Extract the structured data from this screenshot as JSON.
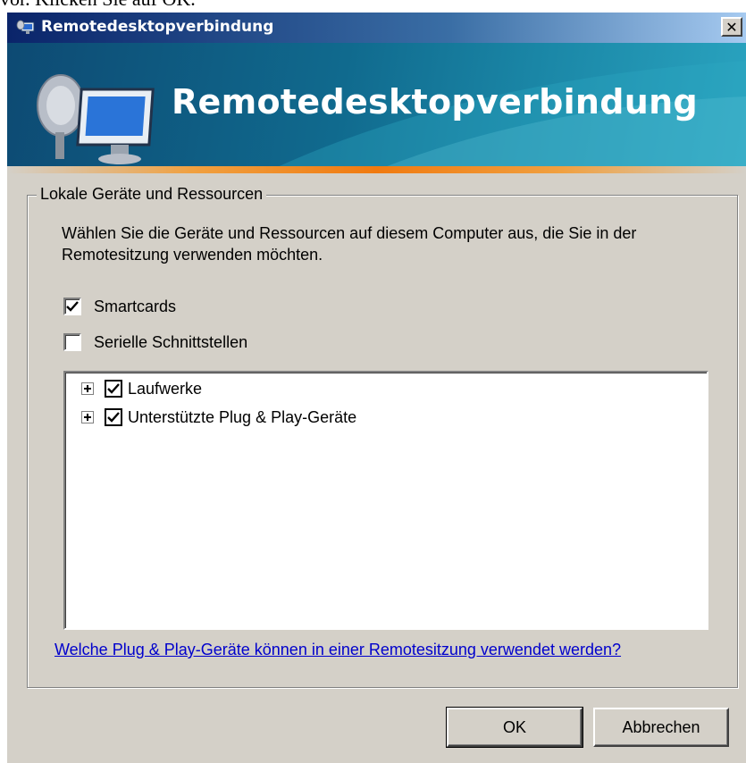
{
  "page_top_text": "vor. Klicken Sie auf OK.",
  "window": {
    "title": "Remotedesktopverbindung",
    "close_label": "✕"
  },
  "banner": {
    "title": "Remotedesktopverbindung"
  },
  "group": {
    "legend": "Lokale Geräte und Ressourcen",
    "description": "Wählen Sie die Geräte und Ressourcen auf diesem Computer aus, die Sie in der Remotesitzung verwenden möchten."
  },
  "checkboxes": [
    {
      "label": "Smartcards",
      "checked": true
    },
    {
      "label": "Serielle Schnittstellen",
      "checked": false
    }
  ],
  "tree": {
    "items": [
      {
        "label": "Laufwerke",
        "checked": true
      },
      {
        "label": "Unterstützte Plug & Play-Geräte",
        "checked": true
      }
    ]
  },
  "help_link": "Welche Plug & Play-Geräte können in einer Remotesitzung verwendet werden?",
  "buttons": {
    "ok": "OK",
    "cancel": "Abbrechen"
  },
  "colors": {
    "dialog_bg": "#d4d0c8",
    "titlebar_start": "#0a246a",
    "banner_bg": "#106a8e",
    "accent_bar": "#f07a10",
    "link": "#0000cc"
  }
}
